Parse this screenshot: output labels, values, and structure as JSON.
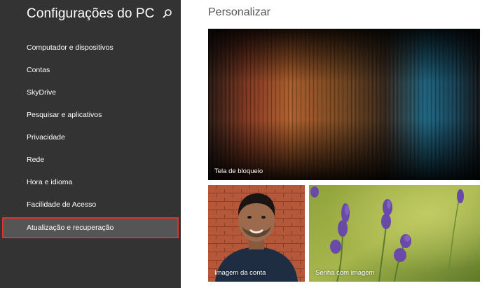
{
  "sidebar": {
    "title": "Configurações do PC",
    "search_icon": "search-icon",
    "items": [
      {
        "label": "Computador e dispositivos"
      },
      {
        "label": "Contas"
      },
      {
        "label": "SkyDrive"
      },
      {
        "label": "Pesquisar e aplicativos"
      },
      {
        "label": "Privacidade"
      },
      {
        "label": "Rede"
      },
      {
        "label": "Hora e idioma"
      },
      {
        "label": "Facilidade de Acesso"
      },
      {
        "label": "Atualização e recuperação",
        "selected": true
      }
    ]
  },
  "main": {
    "title": "Personalizar",
    "tiles": {
      "lock_screen": {
        "label": "Tela de bloqueio"
      },
      "account_picture": {
        "label": "Imagem da conta"
      },
      "picture_password": {
        "label": "Senha com imagem"
      }
    }
  },
  "colors": {
    "sidebar_bg": "#333333",
    "selected_bg": "#555555",
    "selected_border": "#d9342b",
    "main_bg": "#ffffff",
    "title_text": "#555555"
  }
}
